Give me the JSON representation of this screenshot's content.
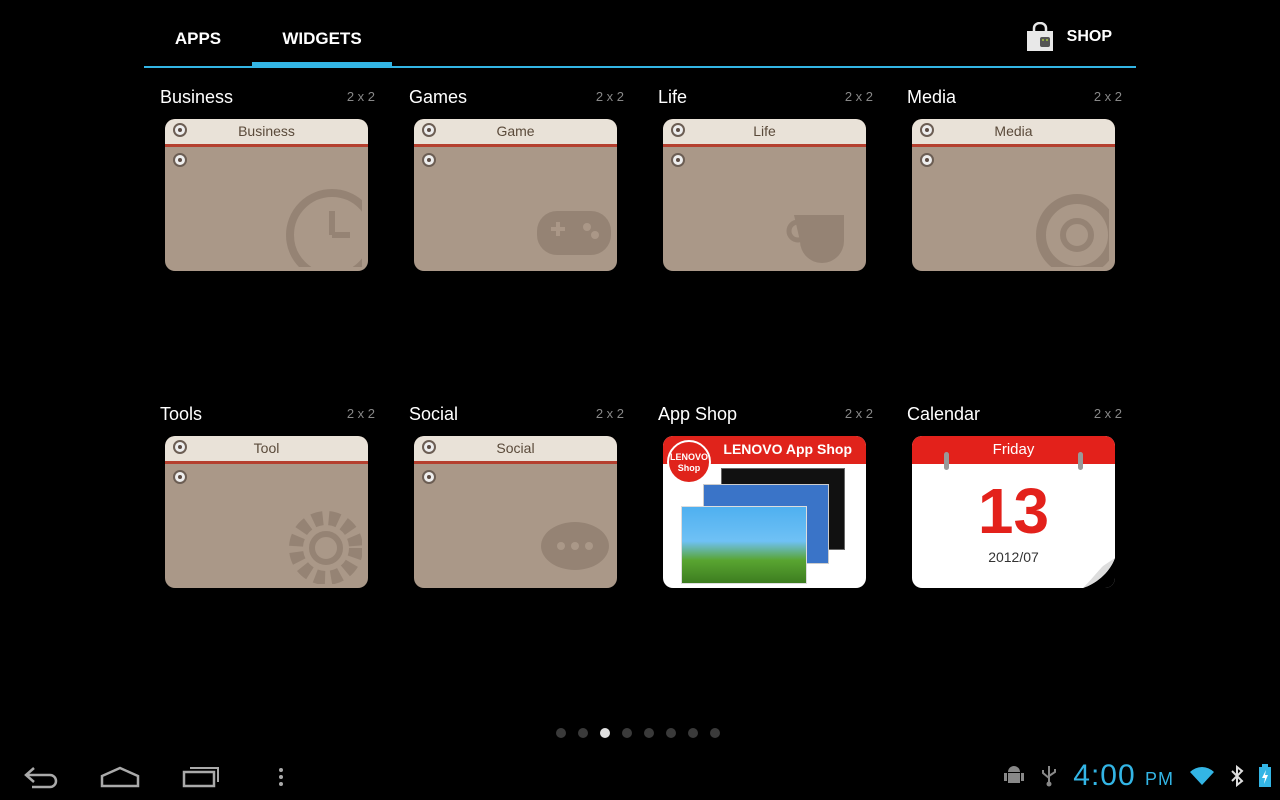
{
  "tabs": [
    {
      "label": "APPS"
    },
    {
      "label": "WIDGETS"
    }
  ],
  "shop": {
    "label": "SHOP",
    "icon": "shopping-bag-icon"
  },
  "widgets": [
    {
      "name": "Business",
      "size": "2 x 2",
      "banner": "Business",
      "icon": "clock-icon"
    },
    {
      "name": "Games",
      "size": "2 x 2",
      "banner": "Game",
      "icon": "gamepad-icon"
    },
    {
      "name": "Life",
      "size": "2 x 2",
      "banner": "Life",
      "icon": "cup-icon"
    },
    {
      "name": "Media",
      "size": "2 x 2",
      "banner": "Media",
      "icon": "disc-icon"
    },
    {
      "name": "Tools",
      "size": "2 x 2",
      "banner": "Tool",
      "icon": "gear-icon"
    },
    {
      "name": "Social",
      "size": "2 x 2",
      "banner": "Social",
      "icon": "chat-icon"
    },
    {
      "name": "App Shop",
      "size": "2 x 2",
      "banner": "LENOVO App Shop",
      "badge": "LENOVO Shop"
    },
    {
      "name": "Calendar",
      "size": "2 x 2",
      "day": "Friday",
      "date": "13",
      "year_month": "2012/07"
    }
  ],
  "pager": {
    "count": 8,
    "active": 2
  },
  "status": {
    "time": "4:00",
    "ampm": "PM"
  },
  "colors": {
    "accent": "#33b5e5",
    "folder": "#aa9888",
    "red": "#e3211b"
  }
}
